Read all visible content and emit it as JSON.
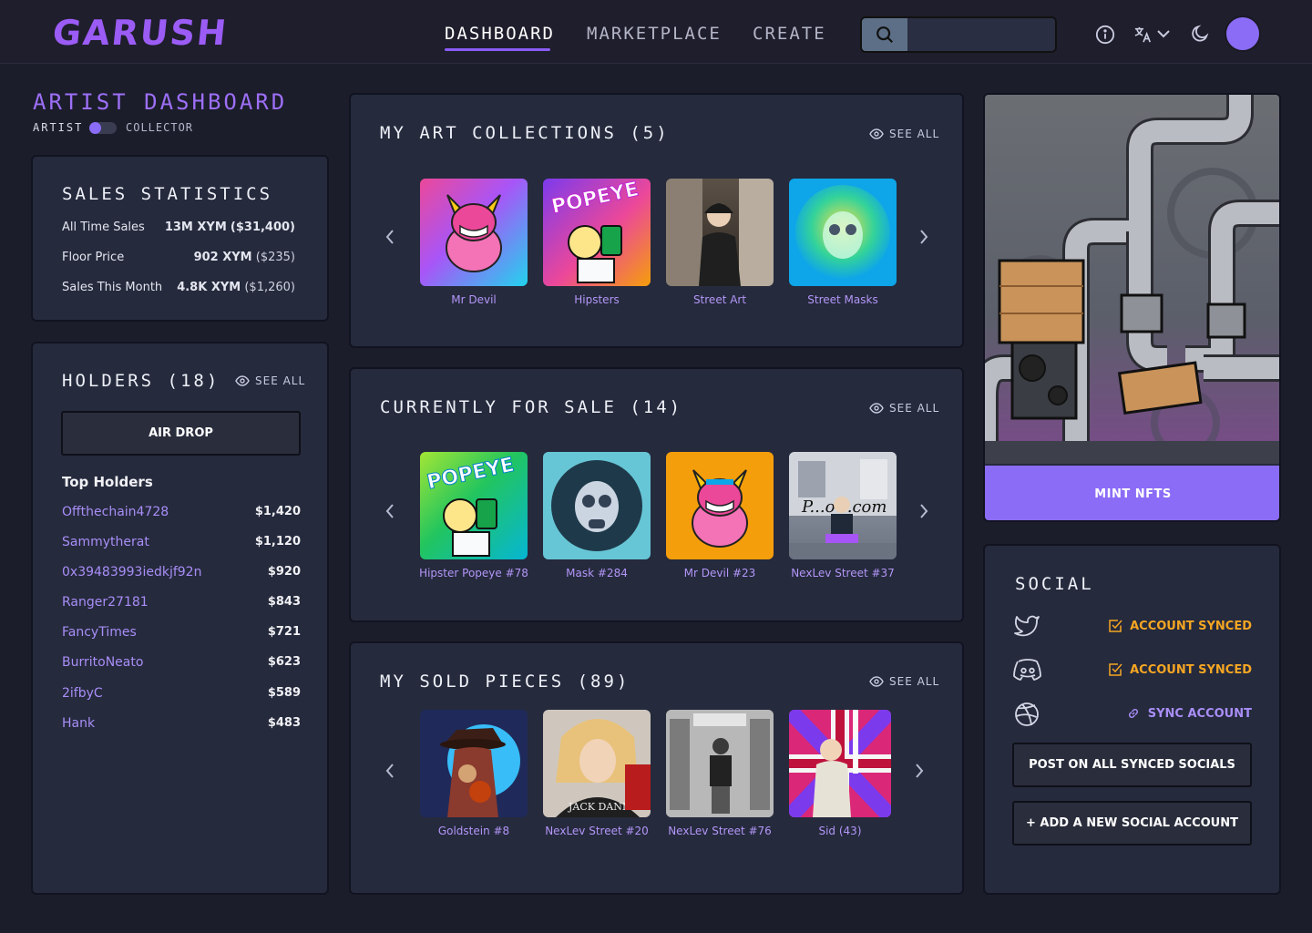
{
  "nav": {
    "logo": "GARUSH",
    "links": [
      "DASHBOARD",
      "MARKETPLACE",
      "CREATE"
    ],
    "search_placeholder": ""
  },
  "dashboard": {
    "title": "ARTIST DASHBOARD",
    "toggle_left": "ARTIST",
    "toggle_right": "COLLECTOR"
  },
  "sales": {
    "title": "SALES STATISTICS",
    "rows": [
      {
        "label": "All Time Sales",
        "value": "13M XYM",
        "sub": "($31,400)"
      },
      {
        "label": "Floor Price",
        "value": "902 XYM",
        "sub": "($235)"
      },
      {
        "label": "Sales This Month",
        "value": "4.8K XYM",
        "sub": "($1,260)"
      }
    ]
  },
  "holders": {
    "title": "HOLDERS (18)",
    "see_all": "SEE ALL",
    "airdrop": "AIR DROP",
    "top_label": "Top Holders",
    "list": [
      {
        "name": "Offthechain4728",
        "value": "$1,420"
      },
      {
        "name": "Sammytherat",
        "value": "$1,120"
      },
      {
        "name": "0x39483993iedkjf92n",
        "value": "$920"
      },
      {
        "name": "Ranger27181",
        "value": "$843"
      },
      {
        "name": "FancyTimes",
        "value": "$721"
      },
      {
        "name": "BurritoNeato",
        "value": "$623"
      },
      {
        "name": "2ifbyC",
        "value": "$589"
      },
      {
        "name": "Hank",
        "value": "$483"
      }
    ]
  },
  "collections": {
    "title": "MY ART COLLECTIONS (5)",
    "see_all": "SEE ALL",
    "items": [
      "Mr Devil",
      "Hipsters",
      "Street Art",
      "Street Masks"
    ]
  },
  "for_sale": {
    "title": "CURRENTLY FOR SALE (14)",
    "see_all": "SEE ALL",
    "items": [
      "Hipster Popeye #78",
      "Mask #284",
      "Mr Devil #23",
      "NexLev Street #37"
    ]
  },
  "sold": {
    "title": "MY SOLD PIECES (89)",
    "see_all": "SEE ALL",
    "items": [
      "Goldstein #8",
      "NexLev Street #20",
      "NexLev Street #76",
      "Sid (43)"
    ]
  },
  "mint": {
    "label": "MINT NFTS"
  },
  "social": {
    "title": "SOCIAL",
    "accounts": [
      {
        "icon": "twitter-icon",
        "status": "ACCOUNT SYNCED"
      },
      {
        "icon": "discord-icon",
        "status": "ACCOUNT SYNCED"
      },
      {
        "icon": "dribbble-icon",
        "status": "SYNC ACCOUNT"
      }
    ],
    "post_all": "POST ON ALL SYNCED SOCIALS",
    "add_new": "+ ADD A NEW SOCIAL ACCOUNT"
  },
  "colors": {
    "accent": "#8b5cf6",
    "synced": "#f5a623",
    "sync_link": "#a98ef7"
  }
}
